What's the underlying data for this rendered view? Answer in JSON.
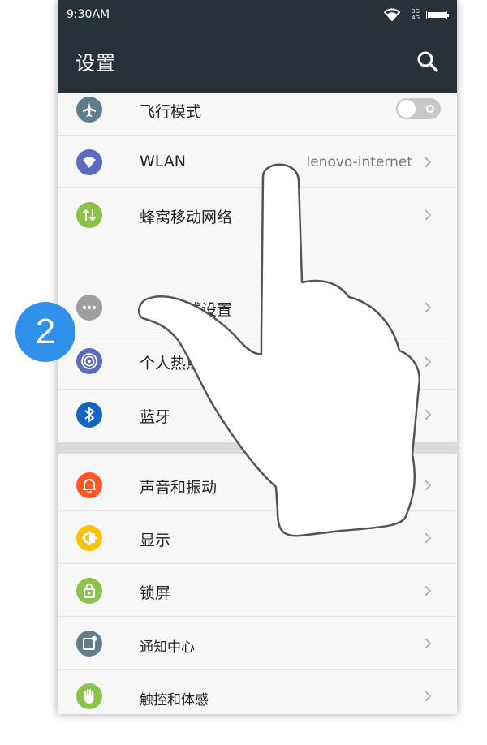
{
  "status": {
    "time": "9:30AM",
    "net_top": "3G",
    "net_bottom": "4G"
  },
  "toolbar": {
    "title": "设置"
  },
  "settings": [
    {
      "label": "飞行模式",
      "icon": "airplane-icon",
      "color": "#607d8b",
      "toggle": "off"
    },
    {
      "label": "WLAN",
      "value": "lenovo-internet",
      "icon": "wifi-icon",
      "color": "#5c6bc0"
    },
    {
      "label": "蜂窝移动网络",
      "icon": "mobile-data-icon",
      "color": "#8bc34a"
    },
    {
      "label": "更多无线设置",
      "icon": "more-icon",
      "color": "#9e9e9e"
    },
    {
      "label": "个人热点",
      "icon": "hotspot-icon",
      "color": "#5c6bc0"
    },
    {
      "label": "蓝牙",
      "icon": "bluetooth-icon",
      "color": "#1565c0"
    },
    {
      "label": "声音和振动",
      "icon": "bell-icon",
      "color": "#ff5722"
    },
    {
      "label": "显示",
      "icon": "brightness-icon",
      "color": "#ffc107"
    },
    {
      "label": "锁屏",
      "icon": "lock-icon",
      "color": "#8bc34a"
    },
    {
      "label": "通知中心",
      "icon": "notification-icon",
      "color": "#607d8b"
    },
    {
      "label": "触控和体感",
      "icon": "touch-icon",
      "color": "#8bc34a"
    }
  ],
  "step_badge": "2"
}
